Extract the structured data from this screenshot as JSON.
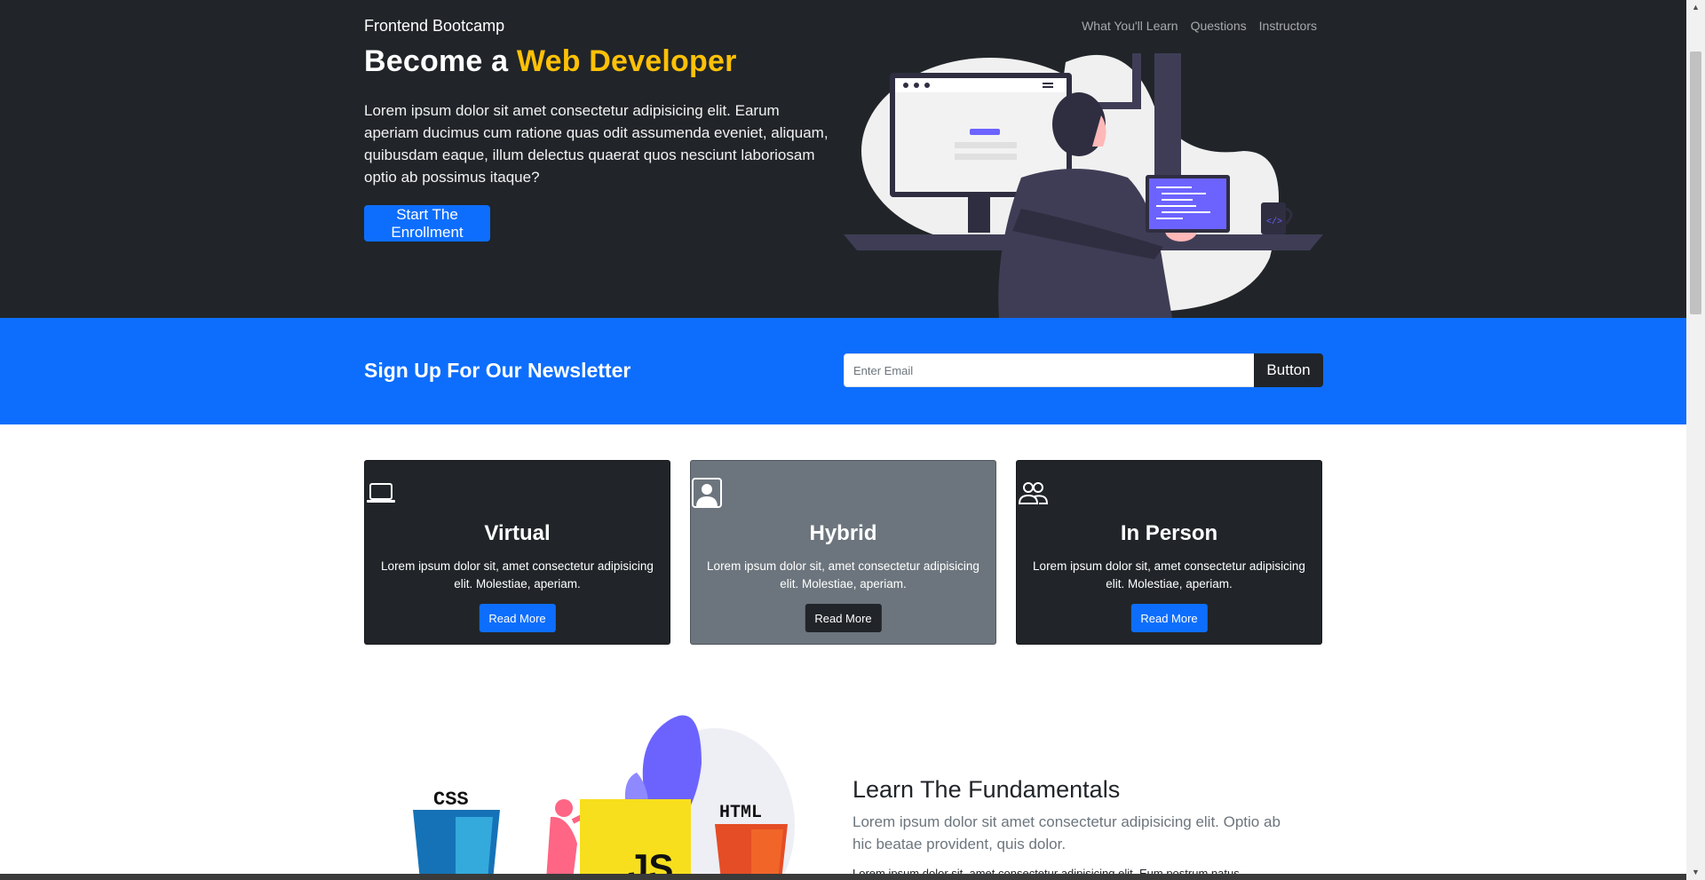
{
  "header": {
    "brand": "Frontend Bootcamp",
    "nav": [
      "What You'll Learn",
      "Questions",
      "Instructors"
    ]
  },
  "hero": {
    "title_prefix": "Become a",
    "title_highlight": "Web Developer",
    "text": "Lorem ipsum dolor sit amet consectetur adipisicing elit. Earum aperiam ducimus cum ratione quas odit assumenda eveniet, aliquam, quibusdam eaque, illum delectus quaerat quos nesciunt laboriosam optio ab possimus itaque?",
    "button": "Start The Enrollment"
  },
  "newsletter": {
    "title": "Sign Up For Our Newsletter",
    "placeholder": "Enter Email",
    "button": "Button"
  },
  "cards": [
    {
      "title": "Virtual",
      "text": "Lorem ipsum dolor sit, amet consectetur adipisicing elit. Molestiae, aperiam.",
      "button": "Read More",
      "icon": "laptop-icon"
    },
    {
      "title": "Hybrid",
      "text": "Lorem ipsum dolor sit, amet consectetur adipisicing elit. Molestiae, aperiam.",
      "button": "Read More",
      "icon": "person-square-icon"
    },
    {
      "title": "In Person",
      "text": "Lorem ipsum dolor sit, amet consectetur adipisicing elit. Molestiae, aperiam.",
      "button": "Read More",
      "icon": "people-icon"
    }
  ],
  "learn": {
    "title": "Learn The Fundamentals",
    "lead": "Lorem ipsum dolor sit amet consectetur adipisicing elit. Optio ab hic beatae provident, quis dolor.",
    "body": "Lorem ipsum dolor sit, amet consectetur adipisicing elit. Eum postrum natus",
    "illustration_labels": [
      "CSS",
      "HTML",
      "JS"
    ]
  },
  "colors": {
    "dark": "#212529",
    "primary": "#0d6efd",
    "warning": "#ffc107",
    "secondary": "#6c757d"
  }
}
